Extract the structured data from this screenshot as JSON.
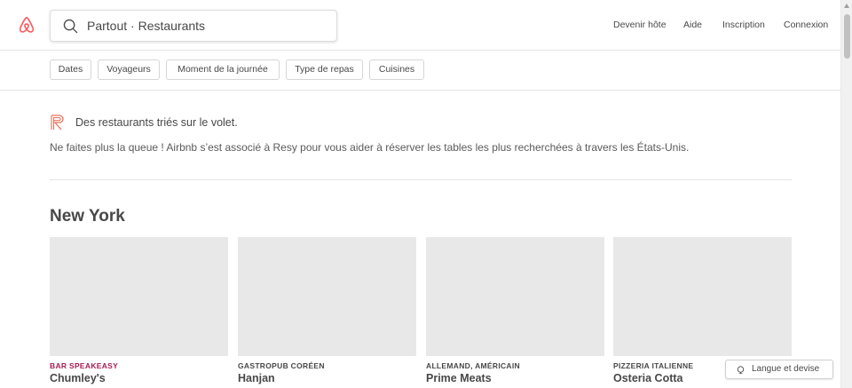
{
  "header": {
    "logo_icon": "airbnb-logo-icon",
    "brand_color": "#FF5A5F",
    "search": {
      "icon": "search-icon",
      "text": "Partout · Restaurants"
    },
    "nav": {
      "host": "Devenir hôte",
      "help": "Aide",
      "signup": "Inscription",
      "login": "Connexion"
    }
  },
  "filters": [
    "Dates",
    "Voyageurs",
    "Moment de la journée",
    "Type de repas",
    "Cuisines"
  ],
  "intro": {
    "icon": "resy-icon",
    "title": "Des restaurants triés sur le volet.",
    "text": "Ne faites plus la queue ! Airbnb s’est associé à Resy pour vous aider à réserver les tables les plus recherchées à travers les États-Unis."
  },
  "section": {
    "city": "New York",
    "restaurants": [
      {
        "category": "BAR SPEAKEASY",
        "name": "Chumley's",
        "category_color": "#A61D55"
      },
      {
        "category": "GASTROPUB CORÉEN",
        "name": "Hanjan",
        "category_color": "#484848"
      },
      {
        "category": "ALLEMAND, AMÉRICAIN",
        "name": "Prime Meats",
        "category_color": "#484848"
      },
      {
        "category": "PIZZERIA ITALIENNE",
        "name": "Osteria Cotta",
        "category_color": "#484848"
      }
    ]
  },
  "footer": {
    "language_icon": "globe-icon",
    "language_label": "Langue et devise"
  }
}
